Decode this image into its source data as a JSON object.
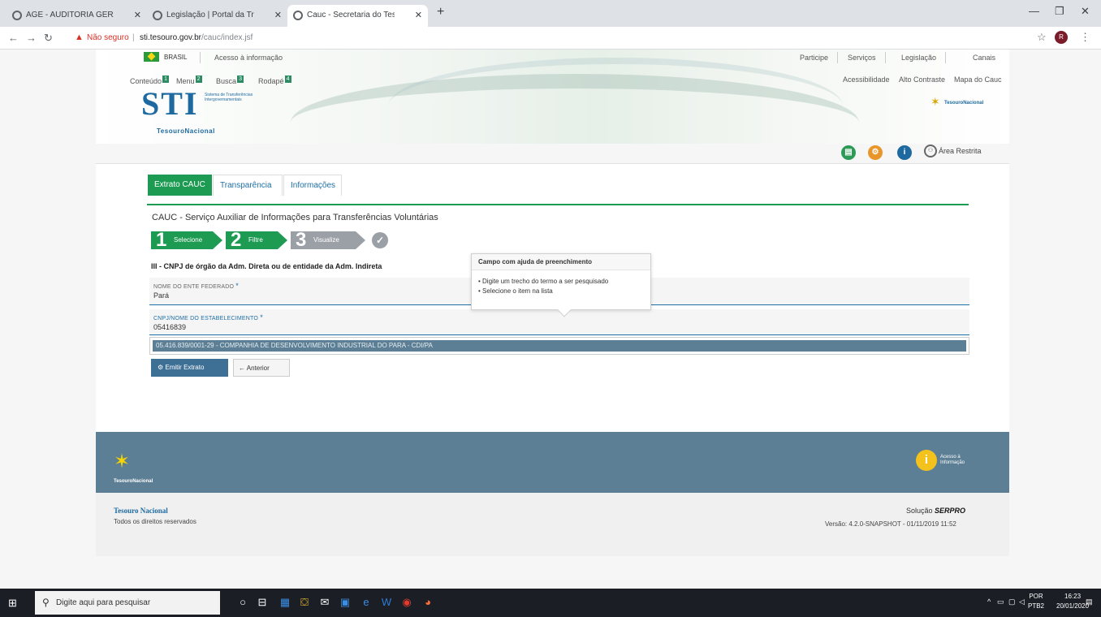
{
  "browser": {
    "tabs": [
      {
        "label": "AGE - AUDITORIA GERAL DO ES",
        "active": false
      },
      {
        "label": "Legislação | Portal da Transparên",
        "active": false
      },
      {
        "label": "Cauc - Secretaria do Tesouro Na",
        "active": true
      }
    ],
    "not_secure_label": "Não seguro",
    "url_host": "sti.tesouro.gov.br",
    "url_path": "/cauc/index.jsf",
    "profile_initial": "R"
  },
  "header": {
    "gov_label": "BRASIL",
    "acesso_info": "Acesso à informação",
    "top_links": [
      "Participe",
      "Serviços",
      "Legislação",
      "Canais"
    ],
    "access_links": [
      {
        "label": "Conteúdo",
        "key": "1"
      },
      {
        "label": "Menu",
        "key": "2"
      },
      {
        "label": "Busca",
        "key": "3"
      },
      {
        "label": "Rodapé",
        "key": "4"
      }
    ],
    "right_links": [
      "Acessibilidade",
      "Alto Contraste",
      "Mapa do Cauc"
    ],
    "logo_text": "STI",
    "logo_sub": "Sistema de Transferências Intergovernamentais",
    "tesouro_label": "TesouroNacional",
    "area_restrita": "Área Restrita"
  },
  "main": {
    "tabs": [
      "Extrato CAUC",
      "Transparência",
      "Informações"
    ],
    "title": "CAUC - Serviço Auxiliar de Informações para Transferências Voluntárias",
    "steps": [
      {
        "num": "1",
        "label": "Selecione"
      },
      {
        "num": "2",
        "label": "Filtre"
      },
      {
        "num": "3",
        "label": "Visualize"
      }
    ],
    "section_label": "III - CNPJ de órgão da Adm. Direta ou de entidade da Adm. Indireta",
    "field1": {
      "label": "Nome do Ente Federado",
      "value": "Pará"
    },
    "field2": {
      "label": "CNPJ/Nome do Estabelecimento",
      "value": "05416839"
    },
    "result": "05.416.839/0001-29 - COMPANHIA DE DESENVOLVIMENTO INDUSTRIAL DO PARA - CDI/PA",
    "btn_emitir": "Emitir Extrato",
    "btn_anterior": "Anterior",
    "tooltip": {
      "title": "Campo com ajuda de preenchimento",
      "items": [
        "Digite um trecho do termo a ser pesquisado",
        "Selecione o item na lista"
      ]
    }
  },
  "footer": {
    "tesouro_label": "TesouroNacional",
    "acesso_info": "Acesso à Informação",
    "org_name": "Tesouro Nacional",
    "rights": "Todos os direitos reservados",
    "solucao": "Solução",
    "serpro": "SERPRO",
    "versao": "Versão: 4.2.0-SNAPSHOT - 01/11/2019 11:52"
  },
  "taskbar": {
    "search_placeholder": "Digite aqui para pesquisar",
    "lang_line1": "POR",
    "lang_line2": "PTB2",
    "time": "16:23",
    "date": "20/01/2020"
  }
}
